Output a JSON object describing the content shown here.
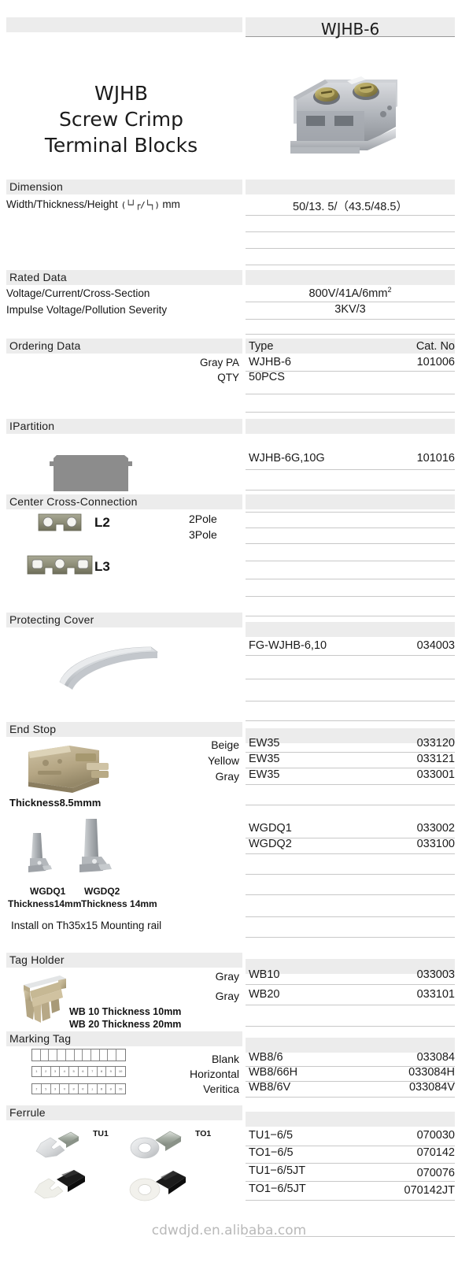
{
  "header": {
    "title_lines": [
      "WJHB",
      "Screw Crimp",
      "Terminal Blocks"
    ],
    "model": "WJHB-6"
  },
  "sections": {
    "dimension": {
      "heading": "Dimension",
      "row_label": "Width/Thickness/Height",
      "profile_symbols": "(└┘┌/└┐)",
      "unit": "mm",
      "value": "50/13. 5/（43.5/48.5）"
    },
    "rated_data": {
      "heading": "Rated  Data",
      "rows": [
        {
          "label": "Voltage/Current/Cross-Section",
          "value": "800V/41A/6mm",
          "sup": "2"
        },
        {
          "label": "Impulse Voltage/Pollution Severity",
          "value": "3KV/3",
          "sup": ""
        }
      ]
    },
    "ordering_data": {
      "heading": "Ordering Data",
      "col_type": "Type",
      "col_cat": "Cat. No",
      "rows": [
        {
          "left": "Gray PA",
          "type": "WJHB-6",
          "cat": "101006"
        },
        {
          "left": "QTY",
          "type": "50PCS",
          "cat": ""
        }
      ]
    },
    "partition": {
      "heading": "IPartition",
      "rows": [
        {
          "type": "WJHB-6G,10G",
          "cat": "101016"
        }
      ]
    },
    "cross_connection": {
      "heading": "Center Cross-Connection",
      "items": [
        {
          "label": "L2",
          "pole": "2Pole"
        },
        {
          "label": "L3",
          "pole": "3Pole"
        }
      ]
    },
    "protecting_cover": {
      "heading": "Protecting Cover",
      "rows": [
        {
          "type": "FG-WJHB-6,10",
          "cat": "034003"
        }
      ]
    },
    "end_stop": {
      "heading": "End Stop",
      "colors": [
        "Beige",
        "Yellow",
        "Gray"
      ],
      "rows": [
        {
          "type": "EW35",
          "cat": "033120"
        },
        {
          "type": "EW35",
          "cat": "033121"
        },
        {
          "type": "EW35",
          "cat": "033001"
        },
        {
          "type": "WGDQ1",
          "cat": "033002"
        },
        {
          "type": "WGDQ2",
          "cat": "033100"
        }
      ],
      "thickness_note": "Thickness8.5mmm",
      "part_labels": [
        "WGDQ1",
        "WGDQ2"
      ],
      "part_thickness": [
        "Thickness14mm",
        "Thickness 14mm"
      ],
      "install_note": "Install on Th35x15 Mounting rail"
    },
    "tag_holder": {
      "heading": "Tag Holder",
      "colors": [
        "Gray",
        "Gray"
      ],
      "rows": [
        {
          "type": "WB10",
          "cat": "033003"
        },
        {
          "type": "WB20",
          "cat": "033101"
        }
      ],
      "notes": [
        "WB 10 Thickness 10mm",
        "WB 20 Thickness 20mm"
      ]
    },
    "marking_tag": {
      "heading": "Marking Tag",
      "orientations": [
        "Blank",
        "Horizontal",
        "Veritica"
      ],
      "rows": [
        {
          "type": "WB8/6",
          "cat": "033084"
        },
        {
          "type": "WB8/66H",
          "cat": "033084H"
        },
        {
          "type": "WB8/6V",
          "cat": "033084V"
        }
      ],
      "grid_numbers": [
        "1",
        "2",
        "3",
        "4",
        "5",
        "6",
        "7",
        "8",
        "9",
        "10"
      ]
    },
    "ferrule": {
      "heading": "Ferrule",
      "image_labels": [
        "TU1",
        "TO1"
      ],
      "rows": [
        {
          "type": "TU1−6/5",
          "cat": "070030"
        },
        {
          "type": "TO1−6/5",
          "cat": "070142"
        },
        {
          "type": "TU1−6/5JT",
          "cat": "070076"
        },
        {
          "type": "TO1−6/5JT",
          "cat": "070142JT"
        }
      ]
    }
  },
  "footer": {
    "watermark": "cdwdjd.en.alibaba.com"
  },
  "colors": {
    "bar_gray": "#ececec",
    "rule_gray": "#c8c8c8",
    "partition_gray": "#8c8c8c",
    "text": "#1a1a1a",
    "watermark": "#b9b9b9"
  }
}
